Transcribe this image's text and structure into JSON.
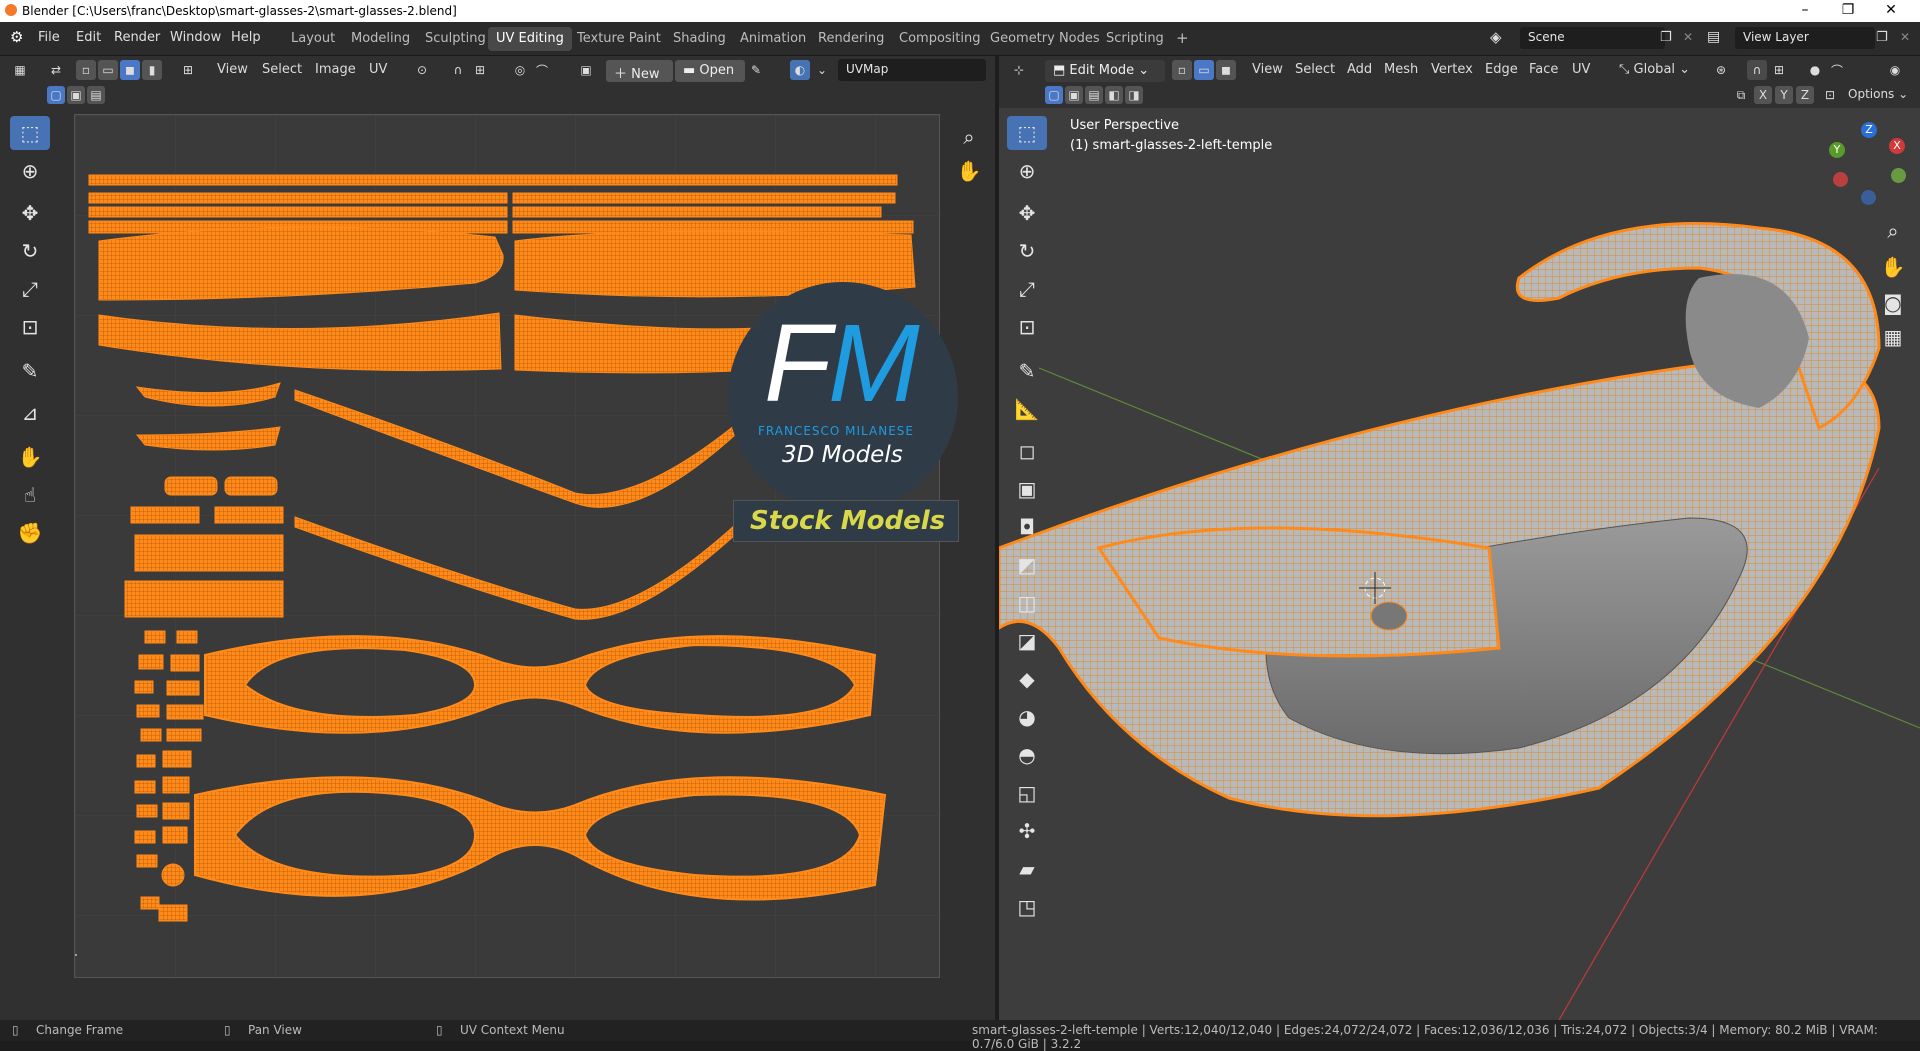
{
  "window": {
    "title": "Blender [C:\\Users\\franc\\Desktop\\smart-glasses-2\\smart-glasses-2.blend]",
    "controls": [
      "–",
      "❐",
      "✕"
    ]
  },
  "menu": [
    "File",
    "Edit",
    "Render",
    "Window",
    "Help"
  ],
  "workspaces": [
    "Layout",
    "Modeling",
    "Sculpting",
    "UV Editing",
    "Texture Paint",
    "Shading",
    "Animation",
    "Rendering",
    "Compositing",
    "Geometry Nodes",
    "Scripting"
  ],
  "active_workspace": "UV Editing",
  "add_workspace": "+",
  "scene": "Scene",
  "view_layer": "View Layer",
  "uv_editor": {
    "menus": [
      "View",
      "Select",
      "Image",
      "UV"
    ],
    "new_label": "New",
    "open_label": "Open",
    "uvmap": "UVMap"
  },
  "viewport": {
    "mode": "Edit Mode",
    "menus": [
      "View",
      "Select",
      "Add",
      "Mesh",
      "Vertex",
      "Edge",
      "Face",
      "UV"
    ],
    "orientation": "Global",
    "options": "Options",
    "axes": [
      "X",
      "Y",
      "Z"
    ],
    "perspective": "User Perspective",
    "object": "(1) smart-glasses-2-left-temple",
    "gizmo": {
      "x": "X",
      "y": "Y",
      "z": "Z"
    }
  },
  "watermark": {
    "initials_f": "F",
    "initials_m": "M",
    "name": "FRANCESCO MILANESE",
    "subtitle": "3D Models",
    "banner": "Stock Models"
  },
  "status": {
    "change_frame": "Change Frame",
    "pan_view": "Pan View",
    "uv_menu": "UV Context Menu",
    "stats": "smart-glasses-2-left-temple | Verts:12,040/12,040 | Edges:24,072/24,072 | Faces:12,036/12,036 | Tris:24,072 | Objects:3/4 | Memory: 80.2 MiB | VRAM: 0.7/6.0 GiB | 3.2.2"
  },
  "colors": {
    "uv": "#ff8a1a",
    "accent": "#4772b3",
    "bg": "#303030"
  }
}
